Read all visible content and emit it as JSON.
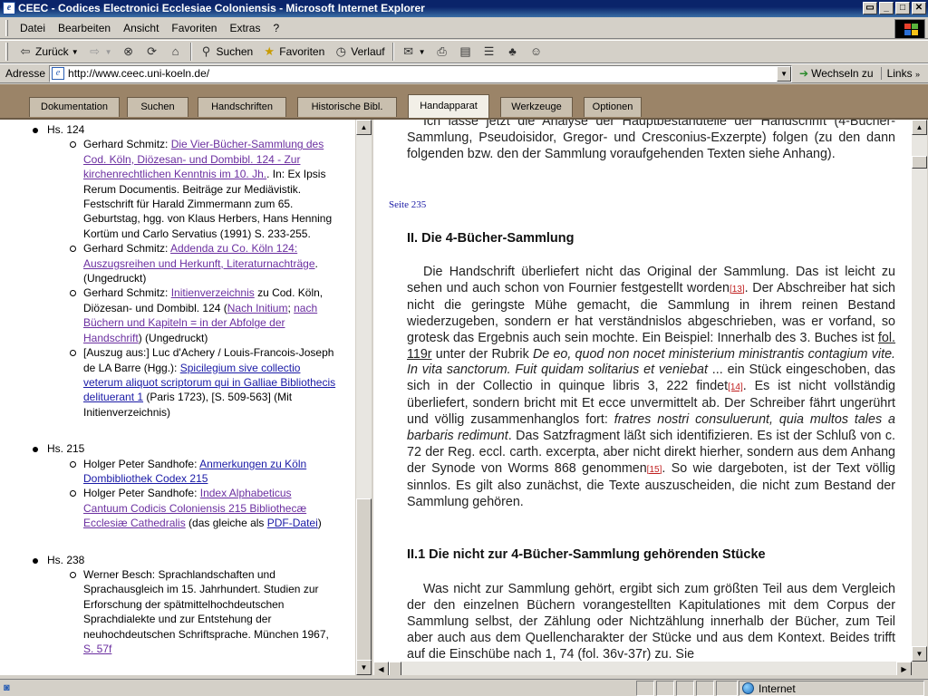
{
  "window": {
    "title": "CEEC - Codices Electronici Ecclesiae Coloniensis - Microsoft Internet Explorer"
  },
  "menu": [
    "Datei",
    "Bearbeiten",
    "Ansicht",
    "Favoriten",
    "Extras",
    "?"
  ],
  "toolbar": {
    "back": "Zurück",
    "search": "Suchen",
    "favorites": "Favoriten",
    "history": "Verlauf"
  },
  "address": {
    "label": "Adresse",
    "url": "http://www.ceec.uni-koeln.de/",
    "go": "Wechseln zu",
    "links": "Links"
  },
  "tabs": [
    {
      "label": "Dokumentation",
      "active": false
    },
    {
      "label": "Suchen",
      "active": false
    },
    {
      "label": "Handschriften",
      "active": false
    },
    {
      "label": "Historische Bibl.",
      "active": false
    },
    {
      "label": "Handapparat",
      "active": true
    },
    {
      "label": "Werkzeuge",
      "active": false
    },
    {
      "label": "Optionen",
      "active": false
    }
  ],
  "left": {
    "hs124": {
      "title": "Hs. 124",
      "e1": {
        "author": "Gerhard Schmitz: ",
        "link": "Die Vier-Bücher-Sammlung des Cod. Köln, Diözesan- und Dombibl. 124 - Zur kirchenrechtlichen Kenntnis im 10. Jh.",
        "rest": ". In: Ex Ipsis Rerum Documentis. Beiträge zur Mediävistik. Festschrift für Harald Zimmermann zum 65. Geburtstag, hgg. von Klaus Herbers, Hans Henning Kortüm und Carlo Servatius (1991) S. 233-255."
      },
      "e2": {
        "author": "Gerhard Schmitz: ",
        "link": "Addenda zu Co. Köln 124: Auszugsreihen und Herkunft, Literaturnachträge",
        "rest": ". (Ungedruckt)"
      },
      "e3": {
        "author": "Gerhard Schmitz: ",
        "link": "Initienverzeichnis",
        "mid": " zu Cod. Köln, Diözesan- und Dombibl. 124 (",
        "link2": "Nach Initium",
        "sep": "; ",
        "link3": "nach Büchern und Kapiteln = in der Abfolge der Handschrift",
        "rest": ") (Ungedruckt)"
      },
      "e4": {
        "author": "[Auszug aus:] Luc d'Achery / Louis-Francois-Joseph de LA Barre (Hgg.): ",
        "link": "Spicilegium sive collectio veterum aliquot scriptorum qui in Galliae Bibliothecis delituerant 1",
        "rest": " (Paris 1723), [S. 509-563] (Mit Initienverzeichnis)"
      }
    },
    "hs215": {
      "title": "Hs. 215",
      "e1": {
        "author": "Holger Peter Sandhofe: ",
        "link": "Anmerkungen zu Köln Dombibliothek Codex 215"
      },
      "e2": {
        "author": "Holger Peter Sandhofe: ",
        "link": "Index Alphabeticus Cantuum Codicis Coloniensis 215 Bibliothecæ Ecclesiæ Cathedralis",
        "mid": " (das gleiche als ",
        "link2": "PDF-Datei",
        "rest": ")"
      }
    },
    "hs238": {
      "title": "Hs. 238",
      "e1": {
        "author": "Werner Besch: Sprachlandschaften und Sprachausgleich im 15. Jahrhundert. Studien zur Erforschung der spätmittelhochdeutschen Sprachdialekte und zur Entstehung der neuhochdeutschen Schriftsprache. München 1967, ",
        "link": "S. 57f"
      }
    }
  },
  "right": {
    "intro": "Ich lasse jetzt die Analyse der Hauptbestandteile der Handschrift (4-Bücher-Sammlung, Pseudoisidor, Gregor- und Cresconius-Exzerpte) folgen (zu den dann folgenden bzw. den der Sammlung voraufgehenden Texten siehe Anhang).",
    "seite": "Seite 235",
    "h2a": "II. Die 4-Bücher-Sammlung",
    "p1": {
      "a": "Die Handschrift überliefert nicht das Original der Sammlung. Das ist leicht zu sehen und auch schon von Fournier festgestellt worden",
      "fn1": "[13]",
      "b": ". Der Abschreiber hat sich nicht die geringste Mühe gemacht, die Sammlung in ihrem reinen Bestand wiederzugeben, sondern er hat verständnislos abgeschrieben, was er vorfand, so grotesk das Ergebnis auch sein mochte. Ein Beispiel: Innerhalb des 3. Buches ist ",
      "ref": "fol. 119r",
      "c": " unter der Rubrik ",
      "i1": "De eo, quod non nocet ministerium ministrantis contagium vite. In vita sanctorum. Fuit quidam solitarius et veniebat",
      "d": " ... ein Stück eingeschoben, das sich in der Collectio in quinque libris 3, 222 findet",
      "fn2": "[14]",
      "e": ". Es ist nicht vollständig überliefert, sondern bricht mit Et ecce unvermittelt ab. Der Schreiber fährt ungerührt und völlig zusammenhanglos fort: ",
      "i2": "fratres nostri consuluerunt, quia multos tales a barbaris redimunt",
      "f": ". Das Satzfragment läßt sich identifizieren. Es ist der Schluß von c. 72 der Reg. eccl. carth. excerpta, aber nicht direkt hierher, sondern aus dem Anhang der Synode von Worms 868 genommen",
      "fn3": "[15]",
      "g": ". So wie dargeboten, ist der Text völlig sinnlos. Es gilt also zunächst, die Texte auszuscheiden, die nicht zum Bestand der Sammlung gehören."
    },
    "h2b": "II.1 Die nicht zur 4-Bücher-Sammlung gehörenden Stücke",
    "p2": "Was nicht zur Sammlung gehört, ergibt sich zum größten Teil aus dem Vergleich der den einzelnen Büchern vorangestellten Kapitulationes mit dem Corpus der Sammlung selbst, der Zählung oder Nichtzählung innerhalb der Bücher, zum Teil aber auch aus dem Quellencharakter der Stücke und aus dem Kontext. Beides trifft auf die Einschübe nach 1, 74 (fol. 36v-37r) zu. Sie"
  },
  "status": {
    "zone": "Internet"
  }
}
